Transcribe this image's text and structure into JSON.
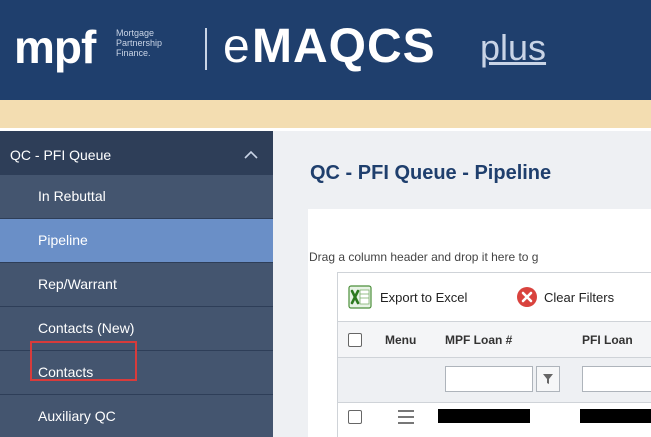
{
  "header": {
    "logo_main": "mpf",
    "logo_subtitle_line1": "Mortgage",
    "logo_subtitle_line2": "Partnership",
    "logo_subtitle_line3": "Finance.",
    "app_name_e": "e",
    "app_name_main": "MAQCS",
    "app_name_plus": "plus",
    "brand_color": "#1f3f6d",
    "band_color": "#f3ddb1"
  },
  "sidebar": {
    "group_label": "QC - PFI Queue",
    "group_icon": "chevron-up-icon",
    "items": [
      {
        "label": "In Rebuttal"
      },
      {
        "label": "Pipeline",
        "active": true
      },
      {
        "label": "Rep/Warrant"
      },
      {
        "label": "Contacts (New)"
      },
      {
        "label": "Contacts",
        "highlighted": true
      },
      {
        "label": "Auxiliary QC"
      }
    ],
    "highlight_color": "#d83b3b",
    "active_color": "#6a8fc7"
  },
  "main": {
    "page_title": "QC - PFI Queue - Pipeline",
    "group_hint": "Drag a column header and drop it here to g",
    "toolbar": {
      "export_label": "Export to Excel",
      "export_icon": "excel-icon",
      "clear_label": "Clear Filters",
      "clear_icon": "clear-filter-icon"
    },
    "grid": {
      "columns": [
        "Menu",
        "MPF Loan #",
        "PFI Loan"
      ],
      "filter_icon": "filter-icon",
      "row_icon": "hamburger-menu-icon"
    }
  }
}
